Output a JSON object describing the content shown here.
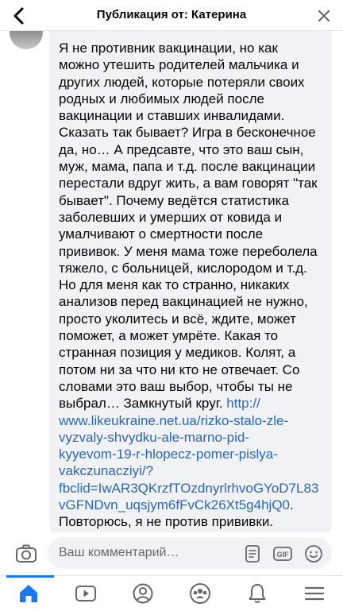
{
  "header": {
    "title": "Публикация от: Катерина"
  },
  "comment": {
    "body": "Я не противник вакцинации, но как\nможно утешить  родителей мальчика и\nдругих людей, которые потеряли  своих\nродных и любимых людей после\nвакцинации и ставших инвалидами.\nСказать так бывает? Игра в бесконечное\nда, но… А предсавте, что это ваш сын,\nмуж, мама, папа и т.д. после вакцинации\nперестали вдруг жить, а вам говорят \"так\nбывает\". Почему ведётся статистика\nзаболевших и умерших от ковида и\nумалчивают  о смертности после\nпрививок. У меня мама тоже переболела\nтяжело, с больницей, кислородом и т.д.\nНо для меня как то странно, никаких\nанализов перед вакцинацией не нужно,\nпросто уколитесь и всё, ждите, может\nпоможет, а может умрёте. Какая то\nстранная позиция у медиков. Колят, а\nпотом ни за что ни кто не отвечает. Со\nсловами это ваш выбор, чтобы ты не\nвыбрал… Замкнутый круг.       ",
    "link": "http://\nwww.likeukraine.net.ua/rizko-stalo-zle-\nvyzvaly-shvydku-ale-marno-pid-\nkyyevom-19-r-hlopecz-pomer-pislya-\nvakczunacziyi/?\nfbclid=IwAR3QKrzfTOzdnyrlrhvoGYoD7L83\nvGFNDvn_uqsjym6fFvCk26Xt5g4hjQ0",
    "link_suffix": ".",
    "tail": "Повторюсь, я не против прививки.\nПросто наверное люди не хотят делать"
  },
  "composer": {
    "placeholder": "Ваш комментарий…",
    "icons": [
      "camera-icon",
      "sticker-icon",
      "gif-icon",
      "emoji-icon"
    ]
  },
  "tabs": [
    {
      "name": "home-icon",
      "active": true
    },
    {
      "name": "video-icon",
      "active": false
    },
    {
      "name": "profile-icon",
      "active": false
    },
    {
      "name": "groups-icon",
      "active": false
    },
    {
      "name": "notifications-icon",
      "active": false
    },
    {
      "name": "menu-icon",
      "active": false
    }
  ],
  "colors": {
    "accent": "#1877f2",
    "link": "#2d65b9",
    "bubble": "#f0f2f5",
    "icon": "#65676b"
  }
}
